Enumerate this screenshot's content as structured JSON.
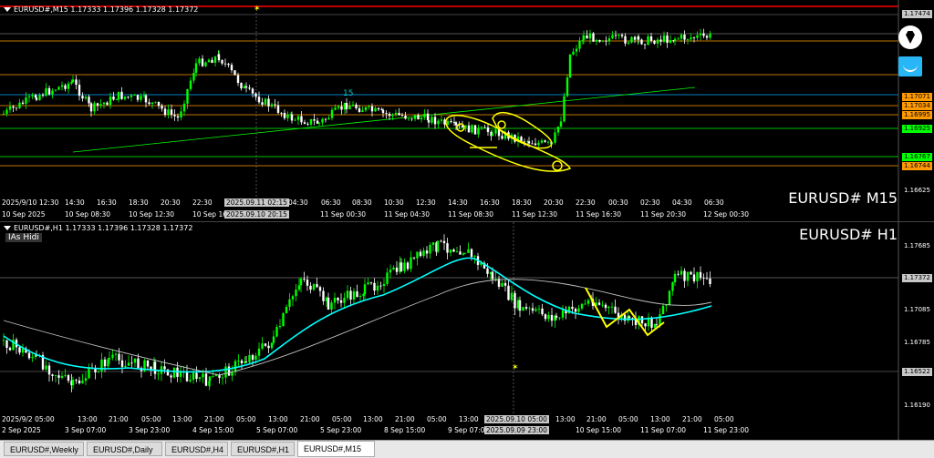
{
  "top_pane": {
    "ohlc_text": "EURUSD#,M15  1.17333 1.17396 1.17328 1.17372",
    "symbol_label": "EURUSD# M15",
    "annotation_number": "15",
    "price_labels": [
      {
        "text": "1.17474",
        "color": "#c8c8c8",
        "text_color": "#000000"
      },
      {
        "text": "1.17071",
        "color": "#ff9900",
        "text_color": "#000000"
      },
      {
        "text": "1.17034",
        "color": "#ff9900",
        "text_color": "#000000"
      },
      {
        "text": "1.16995",
        "color": "#ff9900",
        "text_color": "#000000"
      },
      {
        "text": "1.16925",
        "color": "#00ff00",
        "text_color": "#000000"
      },
      {
        "text": "1.16767",
        "color": "#00ff00",
        "text_color": "#000000"
      },
      {
        "text": "1.16744",
        "color": "#ff9900",
        "text_color": "#000000"
      },
      {
        "text": "1.16625",
        "color": "#000000",
        "text_color": "#ffffff"
      }
    ],
    "x_labels_row1": [
      "2025/9/10 12:30",
      "14:30",
      "16:30",
      "18:30",
      "20:30",
      "22:30",
      "2025.09.11 02:15",
      "04:30",
      "06:30",
      "08:30",
      "10:30",
      "12:30",
      "14:30",
      "16:30",
      "18:30",
      "20:30",
      "22:30",
      "00:30",
      "02:30",
      "04:30",
      "06:30"
    ],
    "x_labels_row2": [
      "10 Sep 2025",
      "10 Sep 08:30",
      "10 Sep 12:30",
      "10 Sep 16:30",
      "2025.09.10 20:15",
      "11 Sep 00:30",
      "11 Sep 04:30",
      "11 Sep 08:30",
      "11 Sep 12:30",
      "11 Sep 16:30",
      "11 Sep 20:30",
      "12 Sep 00:30"
    ]
  },
  "bottom_pane": {
    "ohlc_text": "EURUSD#,H1  1.17333 1.17396 1.17328 1.17372",
    "symbol_label": "EURUSD# H1",
    "badge": "IAs Hidi",
    "price_labels": [
      {
        "text": "1.17685",
        "color": "#000000",
        "text_color": "#ffffff"
      },
      {
        "text": "1.17372",
        "color": "#c8c8c8",
        "text_color": "#000000"
      },
      {
        "text": "1.17085",
        "color": "#000000",
        "text_color": "#ffffff"
      },
      {
        "text": "1.16785",
        "color": "#000000",
        "text_color": "#ffffff"
      },
      {
        "text": "1.16522",
        "color": "#c8c8c8",
        "text_color": "#000000"
      },
      {
        "text": "1.16190",
        "color": "#000000",
        "text_color": "#ffffff"
      }
    ],
    "x_labels_row1": [
      "2025/9/2 05:00",
      "13:00",
      "21:00",
      "05:00",
      "13:00",
      "21:00",
      "05:00",
      "13:00",
      "21:00",
      "05:00",
      "13:00",
      "21:00",
      "05:00",
      "13:00",
      "21:00",
      "2025.09.10 05:00",
      "13:00",
      "21:00",
      "05:00",
      "13:00",
      "21:00",
      "05:00"
    ],
    "x_labels_row2": [
      "2 Sep 2025",
      "3 Sep 07:00",
      "3 Sep 23:00",
      "4 Sep 15:00",
      "5 Sep 07:00",
      "5 Sep 23:00",
      "8 Sep 15:00",
      "9 Sep 07:00",
      "2025.09.09 23:00",
      "10 Sep 15:00",
      "11 Sep 07:00",
      "11 Sep 23:00"
    ]
  },
  "tabs": [
    {
      "label": "EURUSD#,Weekly",
      "active": false
    },
    {
      "label": "EURUSD#,Daily",
      "active": false
    },
    {
      "label": "EURUSD#,H4",
      "active": false
    },
    {
      "label": "EURUSD#,H1",
      "active": false
    },
    {
      "label": "EURUSD#,M15",
      "active": true
    }
  ],
  "colors": {
    "background": "#000000",
    "bull_candle": "#00ff00",
    "bear_candle": "#ffffff",
    "ma_fast": "#00ffff",
    "ma_slow": "#c0c0c0",
    "annotation": "#ffff00",
    "hline_orange": "#ff9900",
    "hline_green": "#00ff00",
    "hline_red": "#ff0000"
  }
}
